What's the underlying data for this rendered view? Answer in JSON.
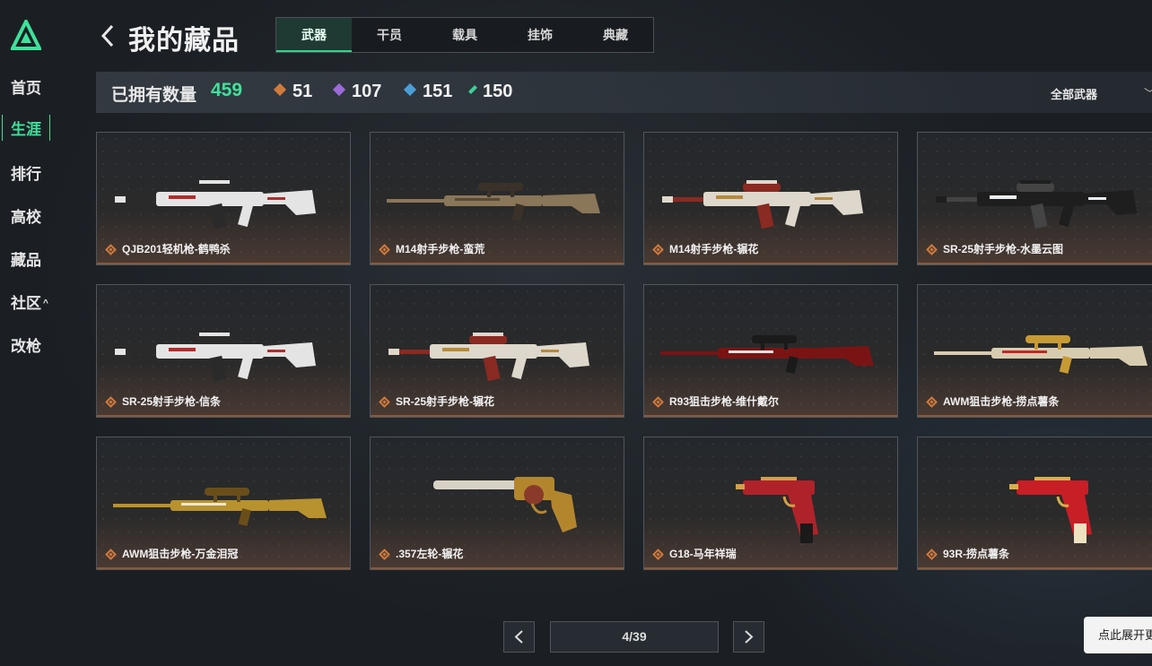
{
  "sidebar": {
    "items": [
      {
        "label": "首页"
      },
      {
        "label": "生涯",
        "active": true
      },
      {
        "label": "排行"
      },
      {
        "label": "高校"
      },
      {
        "label": "藏品"
      },
      {
        "label": "社区",
        "caret": "^"
      },
      {
        "label": "改枪"
      }
    ]
  },
  "header": {
    "title": "我的藏品",
    "tabs": [
      {
        "label": "武器",
        "active": true
      },
      {
        "label": "干员"
      },
      {
        "label": "载具"
      },
      {
        "label": "挂饰"
      },
      {
        "label": "典藏"
      }
    ]
  },
  "stats": {
    "owned_label": "已拥有数量",
    "owned_total": "459",
    "rarities": [
      {
        "count": "51",
        "color": "#d27a3c"
      },
      {
        "count": "107",
        "color": "#9b6ad8"
      },
      {
        "count": "151",
        "color": "#4a9ed8"
      },
      {
        "count": "150",
        "color": "#3fcf9a"
      }
    ],
    "filter_label": "全部武器"
  },
  "items": [
    {
      "name": "QJB201轻机枪-鹤鸭杀",
      "theme": "white"
    },
    {
      "name": "M14射手步枪-蛮荒",
      "theme": "tan"
    },
    {
      "name": "M14射手步枪-辗花",
      "theme": "whitegold"
    },
    {
      "name": "SR-25射手步枪-水墨云图",
      "theme": "black"
    },
    {
      "name": "SR-25射手步枪-信条",
      "theme": "white"
    },
    {
      "name": "SR-25射手步枪-辗花",
      "theme": "whitegold"
    },
    {
      "name": "R93狙击步枪-维什戴尔",
      "theme": "red"
    },
    {
      "name": "AWM狙击步枪-捞点薯条",
      "theme": "goldred"
    },
    {
      "name": "AWM狙击步枪-万金泪冠",
      "theme": "gold"
    },
    {
      "name": ".357左轮-辗花",
      "theme": "revolver"
    },
    {
      "name": "G18-马年祥瑞",
      "theme": "pistolred"
    },
    {
      "name": "93R-捞点薯条",
      "theme": "pistolgold"
    }
  ],
  "pagination": {
    "page": "4/39"
  },
  "expand_button": {
    "label": "点此展开更多"
  },
  "colors": {
    "accent": "#3fe29a",
    "orange_rarity": "#d27a3c"
  }
}
